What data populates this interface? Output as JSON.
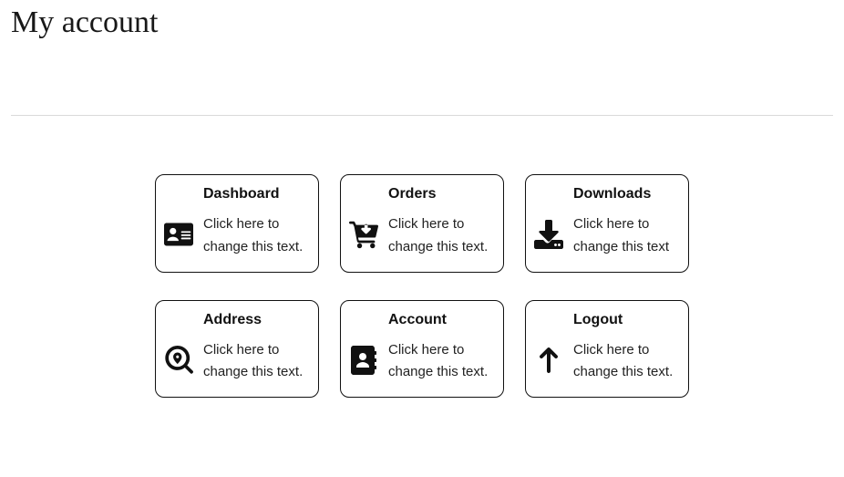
{
  "page": {
    "title": "My account"
  },
  "cards": [
    {
      "id": "dashboard",
      "title": "Dashboard",
      "desc": "Click here to change this text.",
      "icon": "id-card-icon"
    },
    {
      "id": "orders",
      "title": "Orders",
      "desc": "Click here to change this text.",
      "icon": "cart-download-icon"
    },
    {
      "id": "downloads",
      "title": "Downloads",
      "desc": "Click here to change this text",
      "icon": "download-icon"
    },
    {
      "id": "address",
      "title": "Address",
      "desc": "Click here to change this text.",
      "icon": "location-search-icon"
    },
    {
      "id": "account",
      "title": "Account",
      "desc": "Click here to change this text.",
      "icon": "address-book-icon"
    },
    {
      "id": "logout",
      "title": "Logout",
      "desc": "Click here to change this text.",
      "icon": "arrow-up-icon"
    }
  ]
}
